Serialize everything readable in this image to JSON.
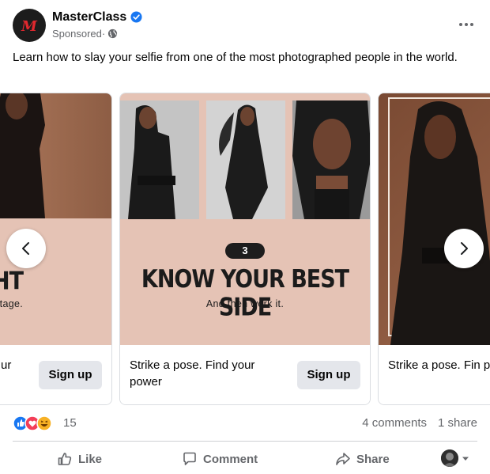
{
  "post": {
    "page_name": "MasterClass",
    "sponsored_label": "Sponsored",
    "meta_separator": " · ",
    "logo_letter": "M",
    "caption": "Learn how to slay your selfie from one of the most photographed people in the world."
  },
  "carousel": {
    "cards": [
      {
        "headline": "R LIGHT",
        "subline": "r advantage.",
        "footer_title": "ur",
        "cta": "Sign up"
      },
      {
        "step": "3",
        "headline": "KNOW YOUR BEST SIDE",
        "subline": "And then work it.",
        "footer_title": "Strike a pose. Find your power",
        "cta": "Sign up"
      },
      {
        "footer_title": "Strike a pose. Fin power"
      }
    ]
  },
  "engagement": {
    "reaction_count": "15",
    "comments": "4 comments",
    "shares": "1 share"
  },
  "actions": {
    "like": "Like",
    "comment": "Comment",
    "share": "Share"
  },
  "colors": {
    "card_peach": "#e5c3b5",
    "brand_blue": "#1877f2",
    "muted_text": "#65676b"
  }
}
